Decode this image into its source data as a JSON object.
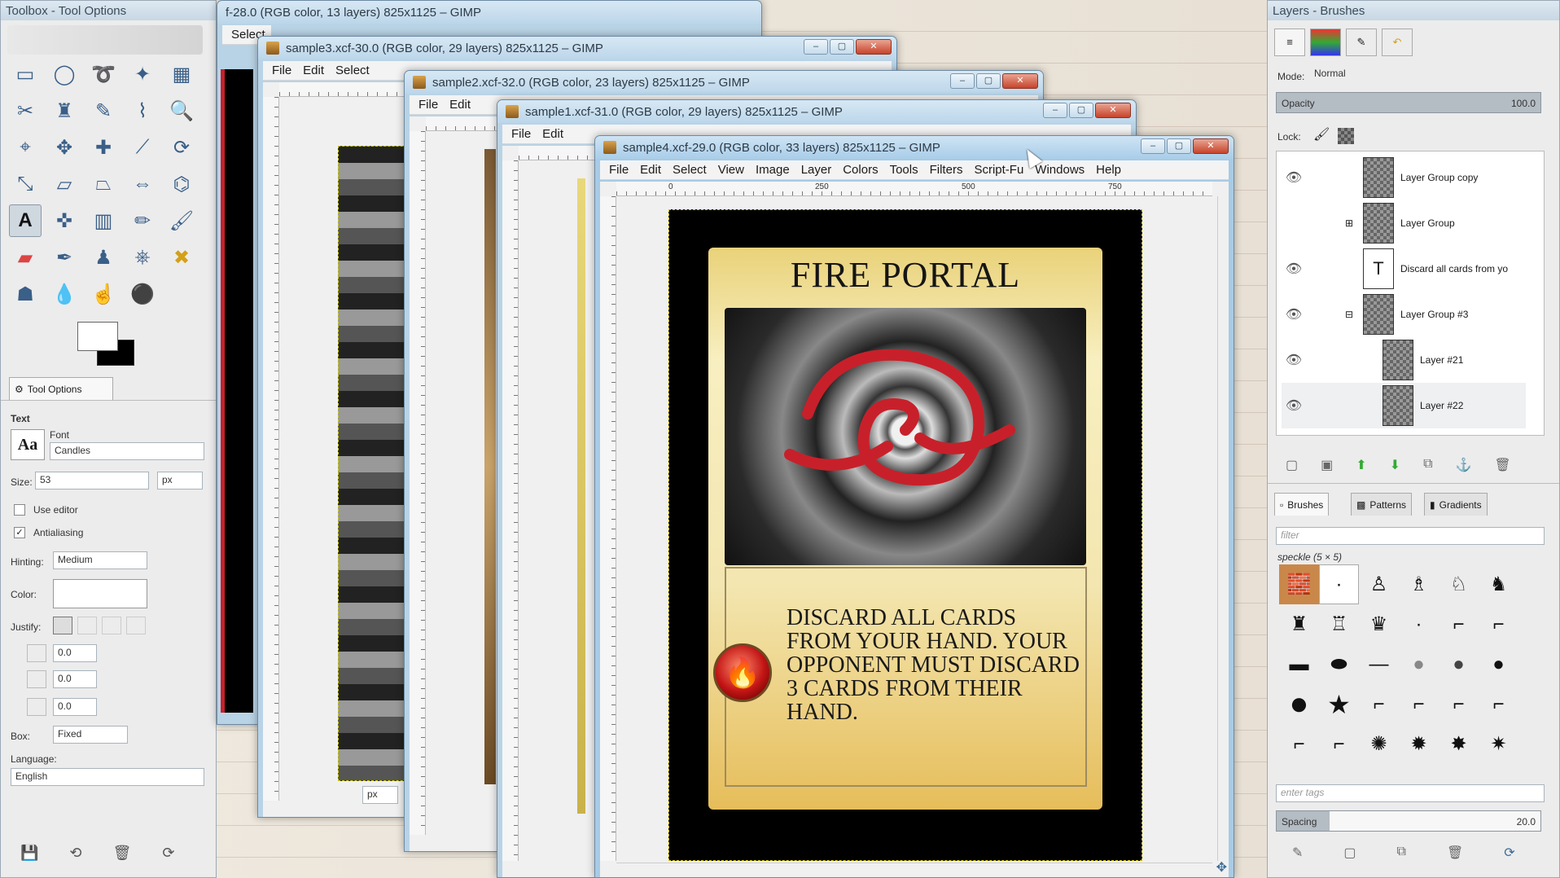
{
  "toolbox": {
    "title": "Toolbox - Tool Options",
    "tab_label": "Tool Options",
    "section": "Text",
    "font_label": "Font",
    "font_value": "Candles",
    "size_label": "Size:",
    "size_value": "53",
    "size_unit": "px",
    "use_editor": "Use editor",
    "antialiasing": "Antialiasing",
    "hinting_label": "Hinting:",
    "hinting_value": "Medium",
    "color_label": "Color:",
    "justify_label": "Justify:",
    "indent_value": "0.0",
    "line_spacing_value": "0.0",
    "letter_spacing_value": "0.0",
    "box_label": "Box:",
    "box_value": "Fixed",
    "language_label": "Language:",
    "language_value": "English",
    "tool_icons": [
      "rect-select",
      "ellipse-select",
      "free-select",
      "fuzzy-select",
      "color-select",
      "scissors",
      "foreground-select",
      "paths",
      "color-picker",
      "zoom",
      "measure",
      "move",
      "align",
      "crop",
      "rotate",
      "scale",
      "shear",
      "perspective",
      "flip",
      "cage",
      "text",
      "heal",
      "blend",
      "pencil",
      "paintbrush",
      "eraser",
      "airbrush",
      "ink",
      "clone",
      "perspective-clone",
      "blur",
      "dodge",
      "smudge",
      "bucket-fill",
      "desaturate"
    ]
  },
  "windows": {
    "back": {
      "title": "f-28.0 (RGB color, 13 layers) 825x1125 – GIMP",
      "menu_select": "Select"
    },
    "sample3": {
      "title": "sample3.xcf-30.0 (RGB color, 29 layers) 825x1125 – GIMP",
      "menu": [
        "File",
        "Edit",
        "Select"
      ],
      "unit": "px"
    },
    "sample2": {
      "title": "sample2.xcf-32.0 (RGB color, 23 layers) 825x1125 – GIMP",
      "menu": [
        "File",
        "Edit"
      ],
      "unit": "px"
    },
    "sample1": {
      "title": "sample1.xcf-31.0 (RGB color, 29 layers) 825x1125 – GIMP",
      "menu": [
        "File",
        "Edit"
      ]
    },
    "sample4": {
      "title": "sample4.xcf-29.0 (RGB color, 33 layers) 825x1125 – GIMP",
      "menu": [
        "File",
        "Edit",
        "Select",
        "View",
        "Image",
        "Layer",
        "Colors",
        "Tools",
        "Filters",
        "Script-Fu",
        "Windows",
        "Help"
      ],
      "ruler": [
        "0",
        "250",
        "500",
        "750"
      ]
    }
  },
  "card": {
    "title": "FIRE PORTAL",
    "text": "DISCARD ALL CARDS FROM YOUR HAND. YOUR OPPONENT MUST DISCARD 3 CARDS FROM THEIR HAND."
  },
  "layers_panel": {
    "title": "Layers - Brushes",
    "mode_label": "Mode:",
    "mode_value": "Normal",
    "opacity_label": "Opacity",
    "opacity_value": "100.0",
    "lock_label": "Lock:",
    "layers": [
      {
        "name": "Layer Group copy"
      },
      {
        "name": "Layer Group"
      },
      {
        "name": "Discard all cards from yo"
      },
      {
        "name": "Layer Group #3"
      },
      {
        "name": "Layer #21"
      },
      {
        "name": "Layer #22"
      }
    ],
    "tabs": [
      "Brushes",
      "Patterns",
      "Gradients"
    ],
    "filter_placeholder": "filter",
    "brush_name": "speckle (5 × 5)",
    "tags_placeholder": "enter tags",
    "spacing_label": "Spacing",
    "spacing_value": "20.0"
  }
}
